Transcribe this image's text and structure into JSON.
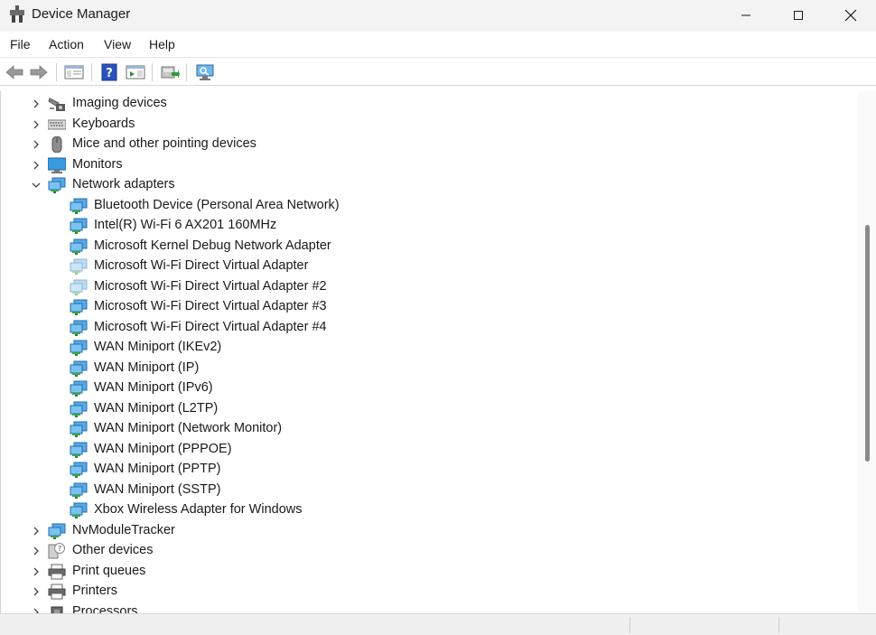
{
  "window": {
    "title": "Device Manager"
  },
  "menu": [
    "File",
    "Action",
    "View",
    "Help"
  ],
  "tree": [
    {
      "label": "Imaging devices",
      "icon": "camera-icon",
      "level": 0,
      "expanded": false
    },
    {
      "label": "Keyboards",
      "icon": "keyboard-icon",
      "level": 0,
      "expanded": false
    },
    {
      "label": "Mice and other pointing devices",
      "icon": "mouse-icon",
      "level": 0,
      "expanded": false
    },
    {
      "label": "Monitors",
      "icon": "monitor-icon",
      "level": 0,
      "expanded": false
    },
    {
      "label": "Network adapters",
      "icon": "network-icon",
      "level": 0,
      "expanded": true
    },
    {
      "label": "Bluetooth Device (Personal Area Network)",
      "icon": "network-icon",
      "level": 1
    },
    {
      "label": "Intel(R) Wi-Fi 6 AX201 160MHz",
      "icon": "network-icon",
      "level": 1
    },
    {
      "label": "Microsoft Kernel Debug Network Adapter",
      "icon": "network-icon",
      "level": 1
    },
    {
      "label": "Microsoft Wi-Fi Direct Virtual Adapter",
      "icon": "network-disabled-icon",
      "level": 1
    },
    {
      "label": "Microsoft Wi-Fi Direct Virtual Adapter #2",
      "icon": "network-disabled-icon",
      "level": 1
    },
    {
      "label": "Microsoft Wi-Fi Direct Virtual Adapter #3",
      "icon": "network-icon",
      "level": 1
    },
    {
      "label": "Microsoft Wi-Fi Direct Virtual Adapter #4",
      "icon": "network-icon",
      "level": 1
    },
    {
      "label": "WAN Miniport (IKEv2)",
      "icon": "network-icon",
      "level": 1
    },
    {
      "label": "WAN Miniport (IP)",
      "icon": "network-icon",
      "level": 1
    },
    {
      "label": "WAN Miniport (IPv6)",
      "icon": "network-icon",
      "level": 1
    },
    {
      "label": "WAN Miniport (L2TP)",
      "icon": "network-icon",
      "level": 1
    },
    {
      "label": "WAN Miniport (Network Monitor)",
      "icon": "network-icon",
      "level": 1
    },
    {
      "label": "WAN Miniport (PPPOE)",
      "icon": "network-icon",
      "level": 1
    },
    {
      "label": "WAN Miniport (PPTP)",
      "icon": "network-icon",
      "level": 1
    },
    {
      "label": "WAN Miniport (SSTP)",
      "icon": "network-icon",
      "level": 1
    },
    {
      "label": "Xbox Wireless Adapter for Windows",
      "icon": "network-icon",
      "level": 1
    },
    {
      "label": "NvModuleTracker",
      "icon": "network-icon",
      "level": 0,
      "expanded": false
    },
    {
      "label": "Other devices",
      "icon": "unknown-device-icon",
      "level": 0,
      "expanded": false
    },
    {
      "label": "Print queues",
      "icon": "printer-icon",
      "level": 0,
      "expanded": false
    },
    {
      "label": "Printers",
      "icon": "printer-icon",
      "level": 0,
      "expanded": false
    },
    {
      "label": "Processors",
      "icon": "processor-icon",
      "level": 0,
      "expanded": false
    }
  ]
}
